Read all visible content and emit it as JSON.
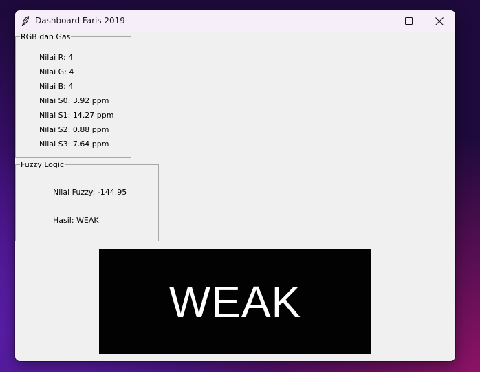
{
  "window": {
    "title": "Dashboard Faris 2019",
    "icons": {
      "app": "feather-icon",
      "minimize": "minimize-icon",
      "maximize": "maximize-icon",
      "close": "close-icon"
    }
  },
  "rgb_gas": {
    "label": "RGB dan Gas",
    "rows": [
      "Nilai R: 4",
      "Nilai G: 4",
      "Nilai B: 4",
      "Nilai S0: 3.92 ppm",
      "Nilai S1: 14.27 ppm",
      "Nilai S2: 0.88 ppm",
      "Nilai S3: 7.64 ppm"
    ]
  },
  "fuzzy": {
    "label": "Fuzzy Logic",
    "value_text": "Nilai Fuzzy: -144.95",
    "result_text": "Hasil: WEAK"
  },
  "result_display": {
    "text": "WEAK",
    "background": "#020202",
    "color": "#ffffff"
  }
}
